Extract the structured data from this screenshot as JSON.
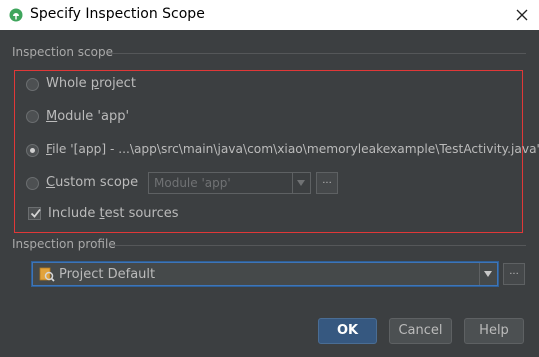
{
  "window": {
    "title": "Specify Inspection Scope",
    "app_icon": "android-studio-icon",
    "close_icon": "close-icon"
  },
  "scope": {
    "section_label": "Inspection scope",
    "options": [
      {
        "label_prefix": "Whole ",
        "label_mnemonic": "p",
        "label_suffix": "roject",
        "selected": false
      },
      {
        "label_prefix": "",
        "label_mnemonic": "M",
        "label_suffix": "odule 'app'",
        "selected": false
      },
      {
        "label_prefix": "",
        "label_mnemonic": "F",
        "label_suffix": "ile '[app] - ...\\app\\src\\main\\java\\com\\xiao\\memoryleakexample\\TestActivity.java'",
        "selected": true
      },
      {
        "label_prefix": "",
        "label_mnemonic": "C",
        "label_suffix": "ustom scope",
        "selected": false
      }
    ],
    "custom_scope_combo_value": "Module 'app'",
    "custom_scope_more": "...",
    "include_tests": {
      "label_prefix": "Include ",
      "label_mnemonic": "t",
      "label_suffix": "est sources",
      "checked": true
    },
    "highlight_color": "#e03838"
  },
  "profile": {
    "section_label": "Inspection profile",
    "value": "Project Default",
    "more": "..."
  },
  "buttons": {
    "ok": "OK",
    "cancel": "Cancel",
    "help": "Help"
  },
  "colors": {
    "background": "#3c3f41",
    "accent": "#365880",
    "text": "#bbbbbb"
  }
}
